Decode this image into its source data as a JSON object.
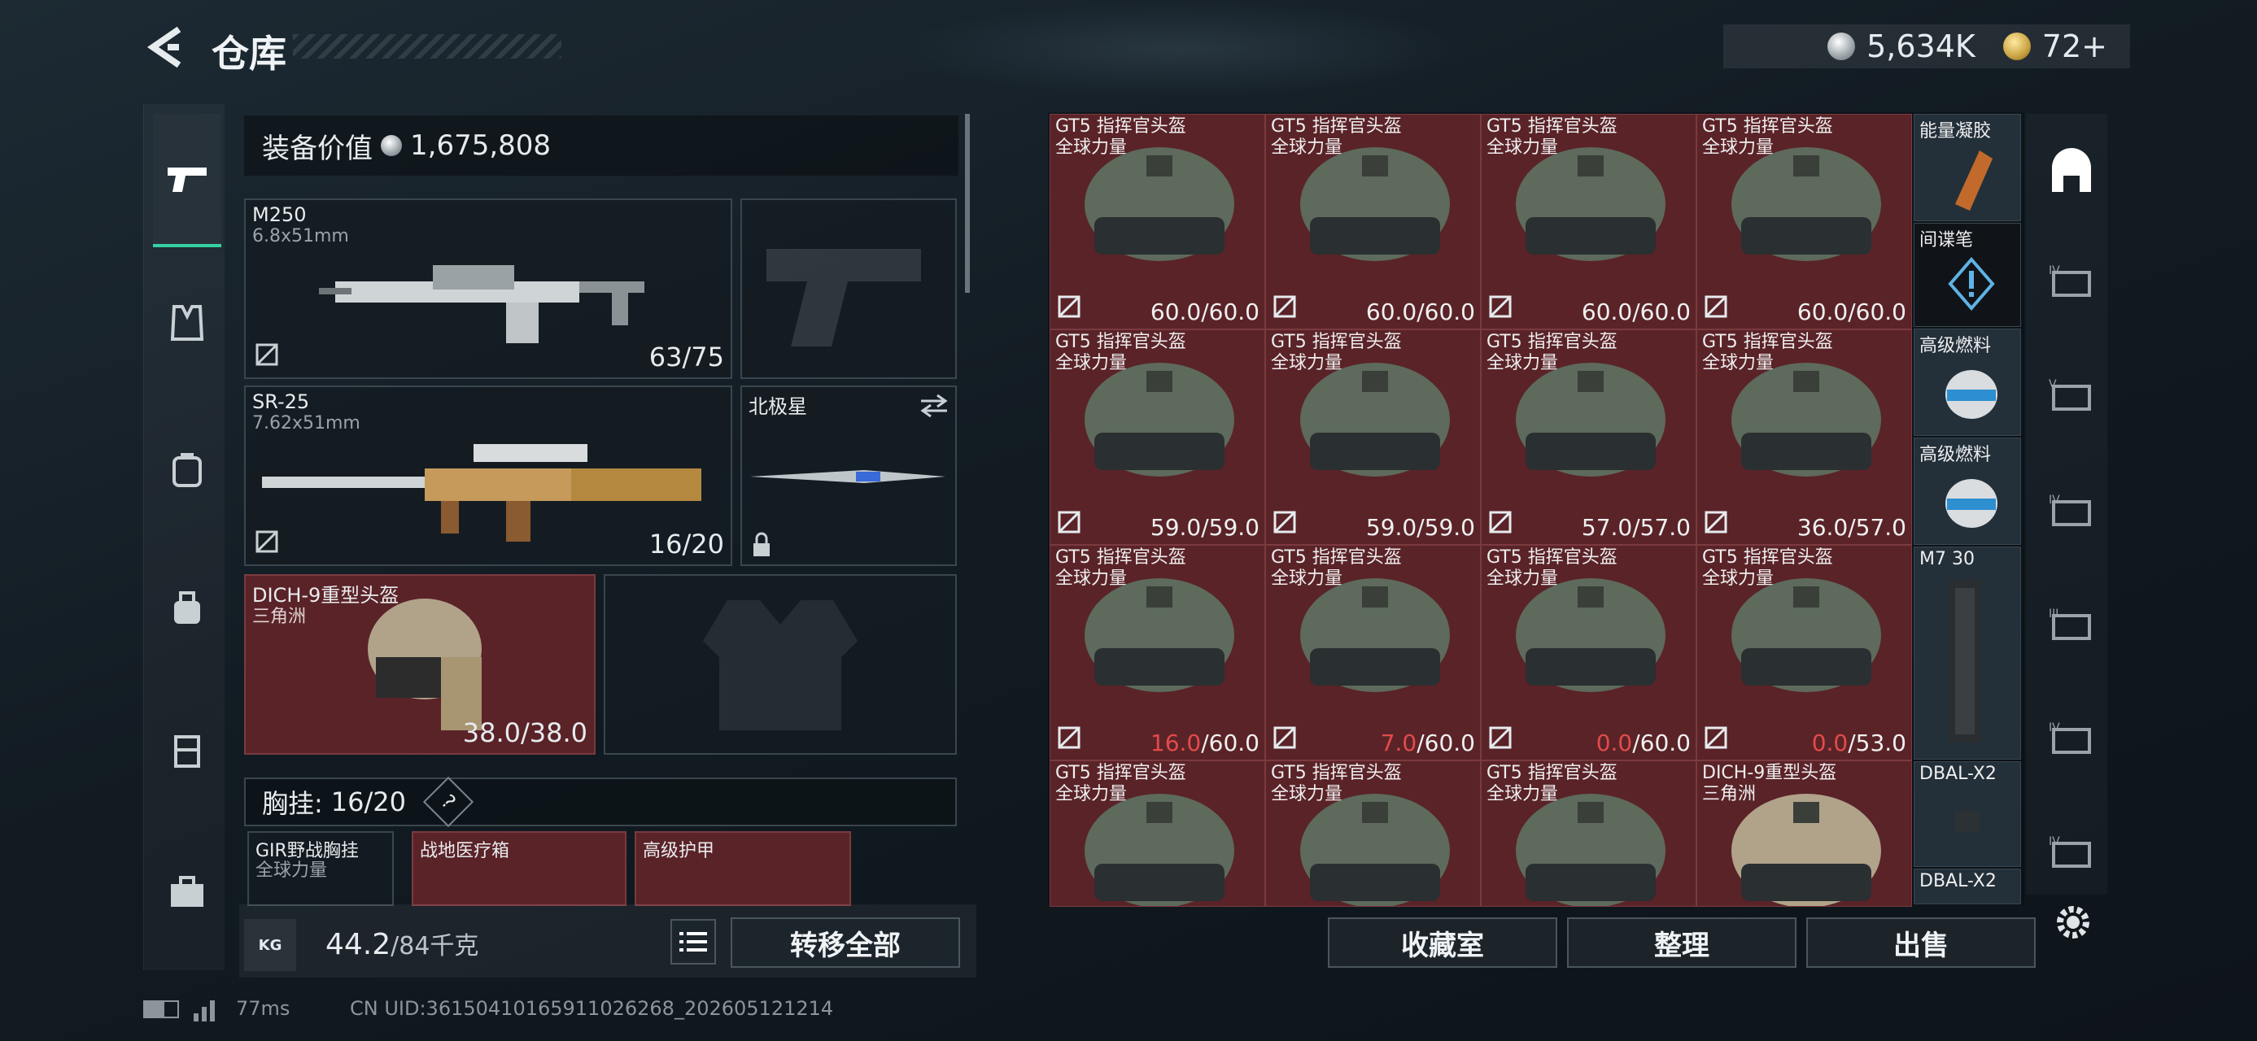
{
  "header": {
    "title": "仓库",
    "currency": "5,634K",
    "gold": "72+"
  },
  "equipment": {
    "label": "装备价值",
    "value": "1,675,808"
  },
  "slots": {
    "primary": {
      "name": "M250",
      "caliber": "6.8x51mm",
      "ammo": "63/75"
    },
    "secondary": {
      "name": "SR-25",
      "caliber": "7.62x51mm",
      "ammo": "16/20"
    },
    "melee": {
      "name": "北极星"
    },
    "helmet": {
      "name": "DICH-9重型头盔",
      "sub": "三角洲",
      "durability": "38.0/38.0"
    }
  },
  "chest": {
    "label": "胸挂:",
    "value": "16/20",
    "help": "?"
  },
  "pack_items": [
    {
      "name": "GIR野战胸挂",
      "sub": "全球力量"
    },
    {
      "name": "战地医疗箱",
      "sub": ""
    },
    {
      "name": "高级护甲",
      "sub": ""
    }
  ],
  "weight": {
    "value": "44.2",
    "max": "/84千克"
  },
  "buttons": {
    "transfer_all": "转移全部",
    "collection": "收藏室",
    "organize": "整理",
    "sell": "出售"
  },
  "stash": [
    {
      "name": "GT5 指挥官头盔",
      "sub": "全球力量",
      "cur": "60.0",
      "max": "/60.0",
      "low": false
    },
    {
      "name": "GT5 指挥官头盔",
      "sub": "全球力量",
      "cur": "60.0",
      "max": "/60.0",
      "low": false
    },
    {
      "name": "GT5 指挥官头盔",
      "sub": "全球力量",
      "cur": "60.0",
      "max": "/60.0",
      "low": false
    },
    {
      "name": "GT5 指挥官头盔",
      "sub": "全球力量",
      "cur": "60.0",
      "max": "/60.0",
      "low": false
    },
    {
      "name": "GT5 指挥官头盔",
      "sub": "全球力量",
      "cur": "59.0",
      "max": "/59.0",
      "low": false
    },
    {
      "name": "GT5 指挥官头盔",
      "sub": "全球力量",
      "cur": "59.0",
      "max": "/59.0",
      "low": false
    },
    {
      "name": "GT5 指挥官头盔",
      "sub": "全球力量",
      "cur": "57.0",
      "max": "/57.0",
      "low": false
    },
    {
      "name": "GT5 指挥官头盔",
      "sub": "全球力量",
      "cur": "36.0",
      "max": "/57.0",
      "low": false
    },
    {
      "name": "GT5 指挥官头盔",
      "sub": "全球力量",
      "cur": "16.0",
      "max": "/60.0",
      "low": true
    },
    {
      "name": "GT5 指挥官头盔",
      "sub": "全球力量",
      "cur": "7.0",
      "max": "/60.0",
      "low": true
    },
    {
      "name": "GT5 指挥官头盔",
      "sub": "全球力量",
      "cur": "0.0",
      "max": "/60.0",
      "low": true
    },
    {
      "name": "GT5 指挥官头盔",
      "sub": "全球力量",
      "cur": "0.0",
      "max": "/53.0",
      "low": true
    },
    {
      "name": "GT5 指挥官头盔",
      "sub": "全球力量",
      "cur": "",
      "max": "",
      "low": false
    },
    {
      "name": "GT5 指挥官头盔",
      "sub": "全球力量",
      "cur": "",
      "max": "",
      "low": false
    },
    {
      "name": "GT5 指挥官头盔",
      "sub": "全球力量",
      "cur": "",
      "max": "",
      "low": false
    },
    {
      "name": "DICH-9重型头盔",
      "sub": "三角洲",
      "cur": "",
      "max": "",
      "low": false
    }
  ],
  "side_items": [
    "能量凝胶",
    "间谍笔",
    "高级燃料",
    "高级燃料",
    "M7 30",
    "DBAL-X2",
    "DBAL-X2"
  ],
  "status": {
    "ping": "77ms",
    "uid": "CN UID:36150410165911026268_202605121214"
  }
}
